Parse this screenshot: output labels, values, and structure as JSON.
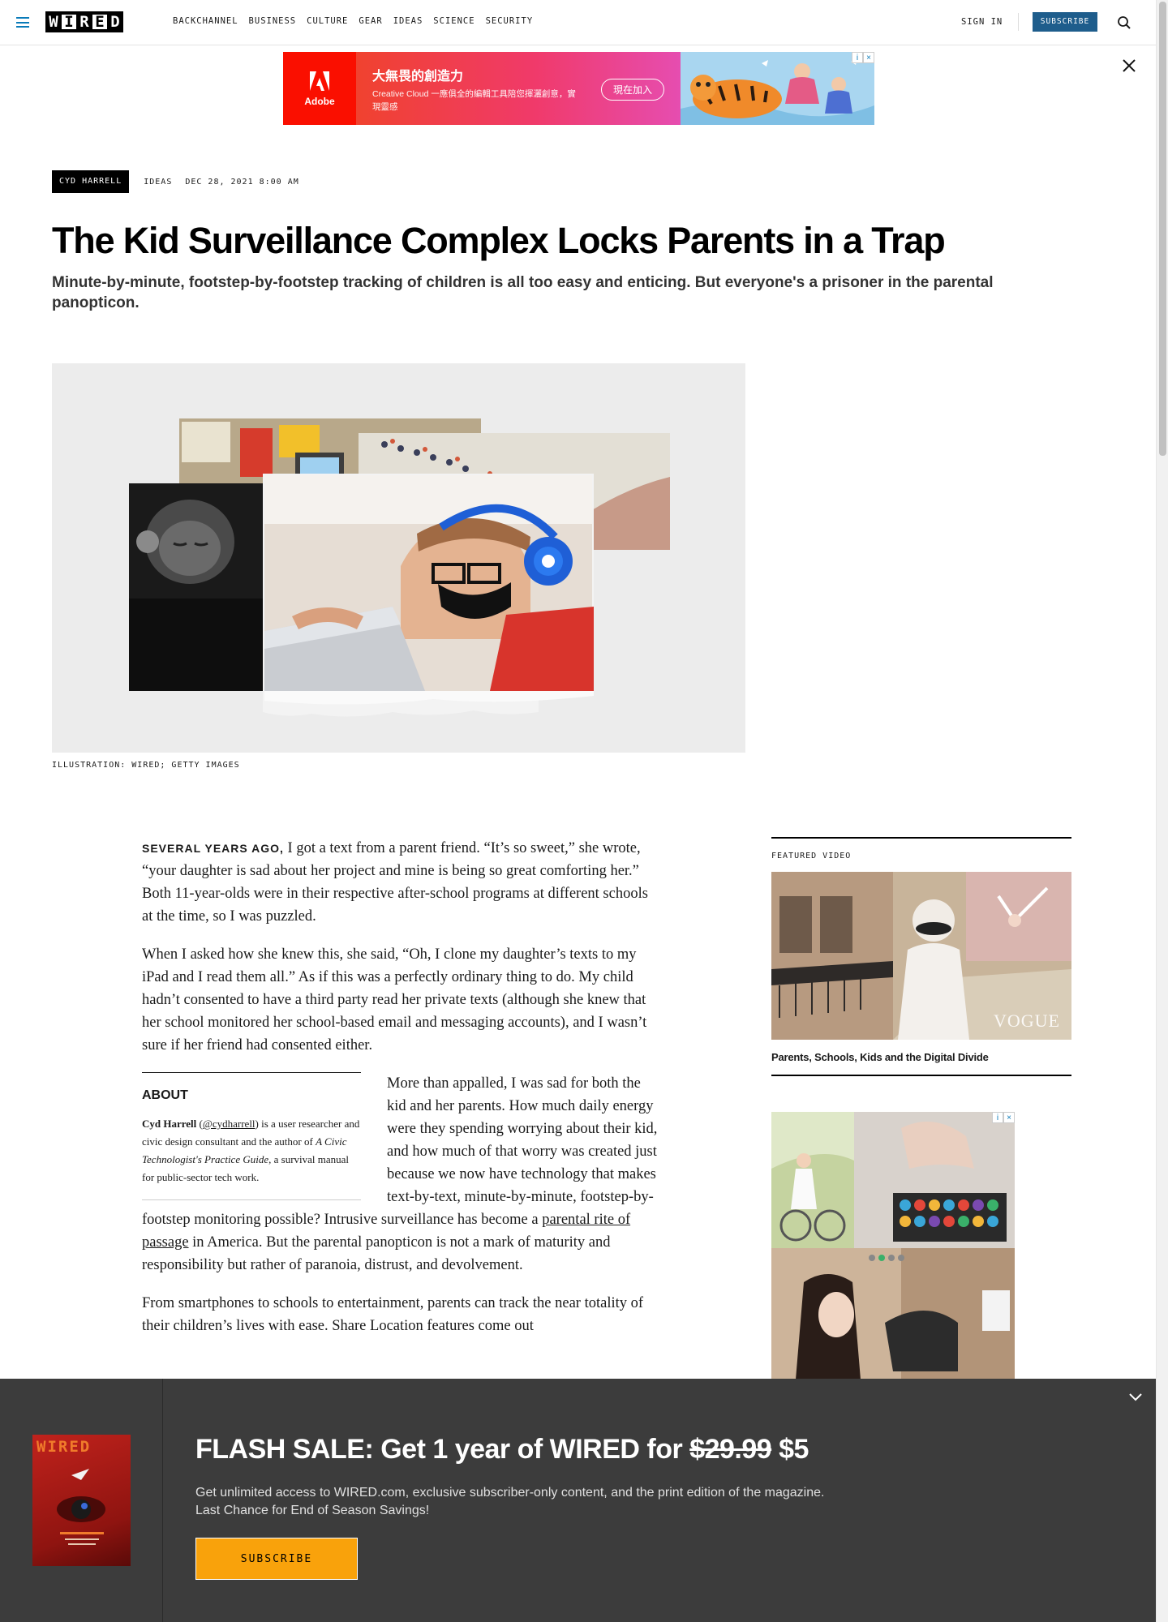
{
  "nav": {
    "logo": [
      "W",
      "I",
      "R",
      "E",
      "D"
    ],
    "links": [
      "BACKCHANNEL",
      "BUSINESS",
      "CULTURE",
      "GEAR",
      "IDEAS",
      "SCIENCE",
      "SECURITY"
    ],
    "sign_in": "SIGN IN",
    "subscribe": "SUBSCRIBE"
  },
  "ad_banner": {
    "brand": "Adobe",
    "headline": "大無畏的創造力",
    "text": "Creative Cloud 一應俱全的編輯工具陪您揮灑創意，實現靈感",
    "cta": "現在加入"
  },
  "article": {
    "author": "CYD HARRELL",
    "category": "IDEAS",
    "date": "DEC 28, 2021 8:00 AM",
    "headline": "The Kid Surveillance Complex Locks Parents in a Trap",
    "dek": "Minute-by-minute, footstep-by-footstep tracking of children is all too easy and enticing. But everyone's a prisoner in the parental panopticon.",
    "image_caption": "ILLUSTRATION: WIRED; GETTY IMAGES",
    "lead_in": "SEVERAL YEARS AGO,",
    "p1": " I got a text from a parent friend. “It’s so sweet,” she wrote, “your daughter is sad about her project and mine is being so great comforting her.” Both 11-year-olds were in their respective after-school programs at different schools at the time, so I was puzzled.",
    "p2": "When I asked how she knew this, she said, “Oh, I clone my daughter’s texts to my iPad and I read them all.” As if this was a perfectly ordinary thing to do. My child hadn’t consented to have a third party read her private texts (although she knew that her school monitored her school-based email and messaging accounts), and I wasn’t sure if her friend had consented either.",
    "p3_a": "More than appalled, I was sad for both the kid and her parents. How much daily energy were they spending worrying about their kid, and how much of that worry was created just because we now have technology that makes text-by-text, minute-by-minute, footstep-by-footstep monitoring possible? Intrusive surveillance has become a ",
    "p3_link": "parental rite of passage",
    "p3_b": " in America. But the parental panopticon is not a mark of maturity and responsibility but rather of paranoia, distrust, and devolvement.",
    "p4": "From smartphones to schools to entertainment, parents can track the near totality of their children’s lives with ease. Share Location features come out",
    "about": {
      "heading": "ABOUT",
      "name": "Cyd Harrell",
      "handle": "@cydharrell",
      "text_a": ") is a user researcher and civic design consultant and the author of ",
      "book": "A Civic Technologist's Practice Guide",
      "text_b": ", a survival manual for public-sector tech work.",
      "open_paren": " ("
    }
  },
  "sidebar": {
    "featured_label": "FEATURED VIDEO",
    "video_watermark": "VOGUE",
    "video_title": "Parents, Schools, Kids and the Digital Divide"
  },
  "flash_sale": {
    "headline_a": "FLASH SALE: Get 1 year of WIRED for ",
    "old_price": "$29.99",
    "new_price": " $5",
    "line1": "Get unlimited access to WIRED.com, exclusive subscriber-only content, and the print edition of the magazine.",
    "line2": "Last Chance for End of Season Savings!",
    "button": "SUBSCRIBE",
    "cover_logo": "WIRED"
  },
  "colors": {
    "accent_blue": "#1e5d8c",
    "nav_icon_blue": "#0a7bb9",
    "flash_bg": "#3c3c3c",
    "flash_button": "#f9a20b",
    "adobe_red": "#fa0f00"
  }
}
